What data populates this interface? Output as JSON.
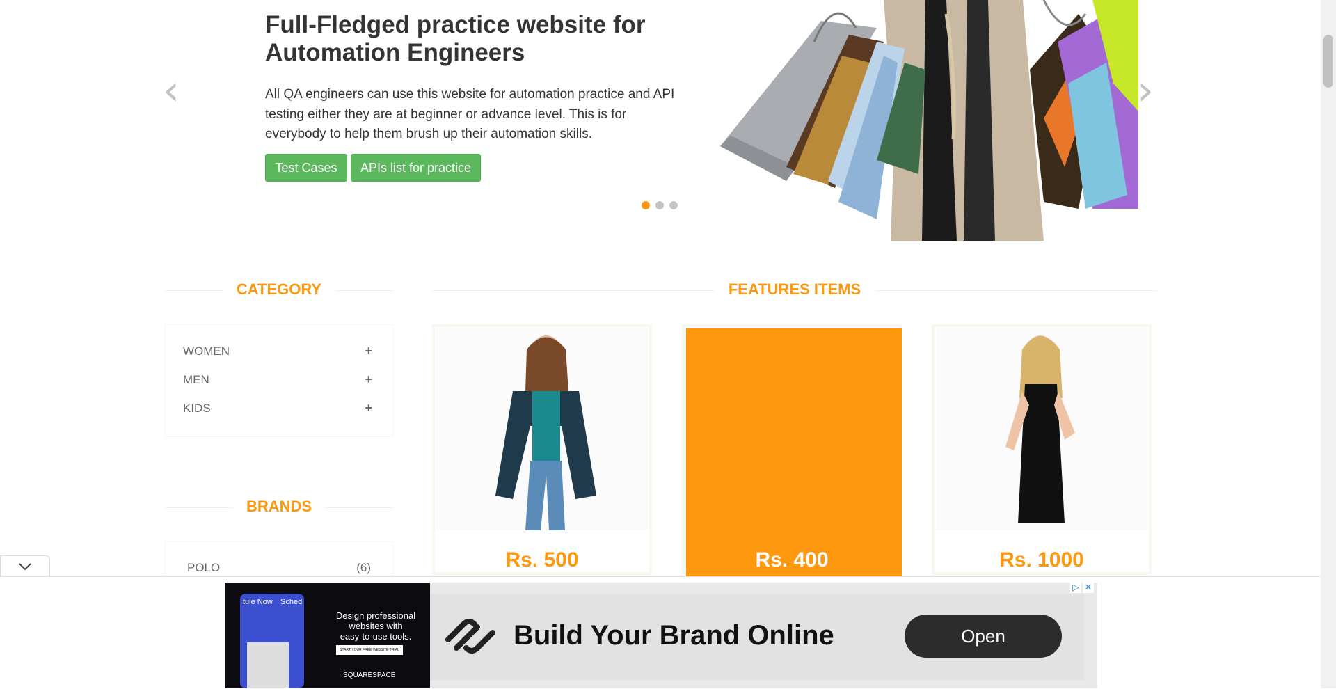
{
  "slider": {
    "title_line1": "Full-Fledged practice website for",
    "title_line2": "Automation Engineers",
    "text": "All QA engineers can use this website for automation practice and API testing either they are at beginner or advance level. This is for everybody to help them brush up their automation skills.",
    "button_test_cases": "Test Cases",
    "button_apis": "APIs list for practice",
    "prev_icon": "‹",
    "next_icon": "›",
    "active_dot": 1,
    "dot_count": 3
  },
  "category": {
    "title": "CATEGORY",
    "items": [
      {
        "label": "WOMEN",
        "icon": "+"
      },
      {
        "label": "MEN",
        "icon": "+"
      },
      {
        "label": "KIDS",
        "icon": "+"
      }
    ]
  },
  "brands": {
    "title": "BRANDS",
    "items": [
      {
        "label": "POLO",
        "count": "(6)"
      }
    ]
  },
  "features": {
    "title": "FEATURES ITEMS",
    "products": [
      {
        "price": "Rs. 500"
      },
      {
        "price": "Rs. 400"
      },
      {
        "price": "Rs. 1000"
      }
    ]
  },
  "ad": {
    "headline": "Build Your Brand Online",
    "cta": "Open",
    "promo_line1": "Design professional",
    "promo_line2": "websites with",
    "promo_line3": "easy-to-use tools.",
    "promo_button": "START YOUR FREE WEBSITE TRIAL",
    "brand": "SQUARESPACE",
    "phone_tab1": "tule Now",
    "phone_tab2": "Sched",
    "toggle_icon": "chevron-down-icon",
    "adchoices_icon": "▷",
    "close_icon": "✕"
  },
  "colors": {
    "accent": "#fe980f",
    "button_green": "#5cb85c",
    "text": "#363432"
  }
}
